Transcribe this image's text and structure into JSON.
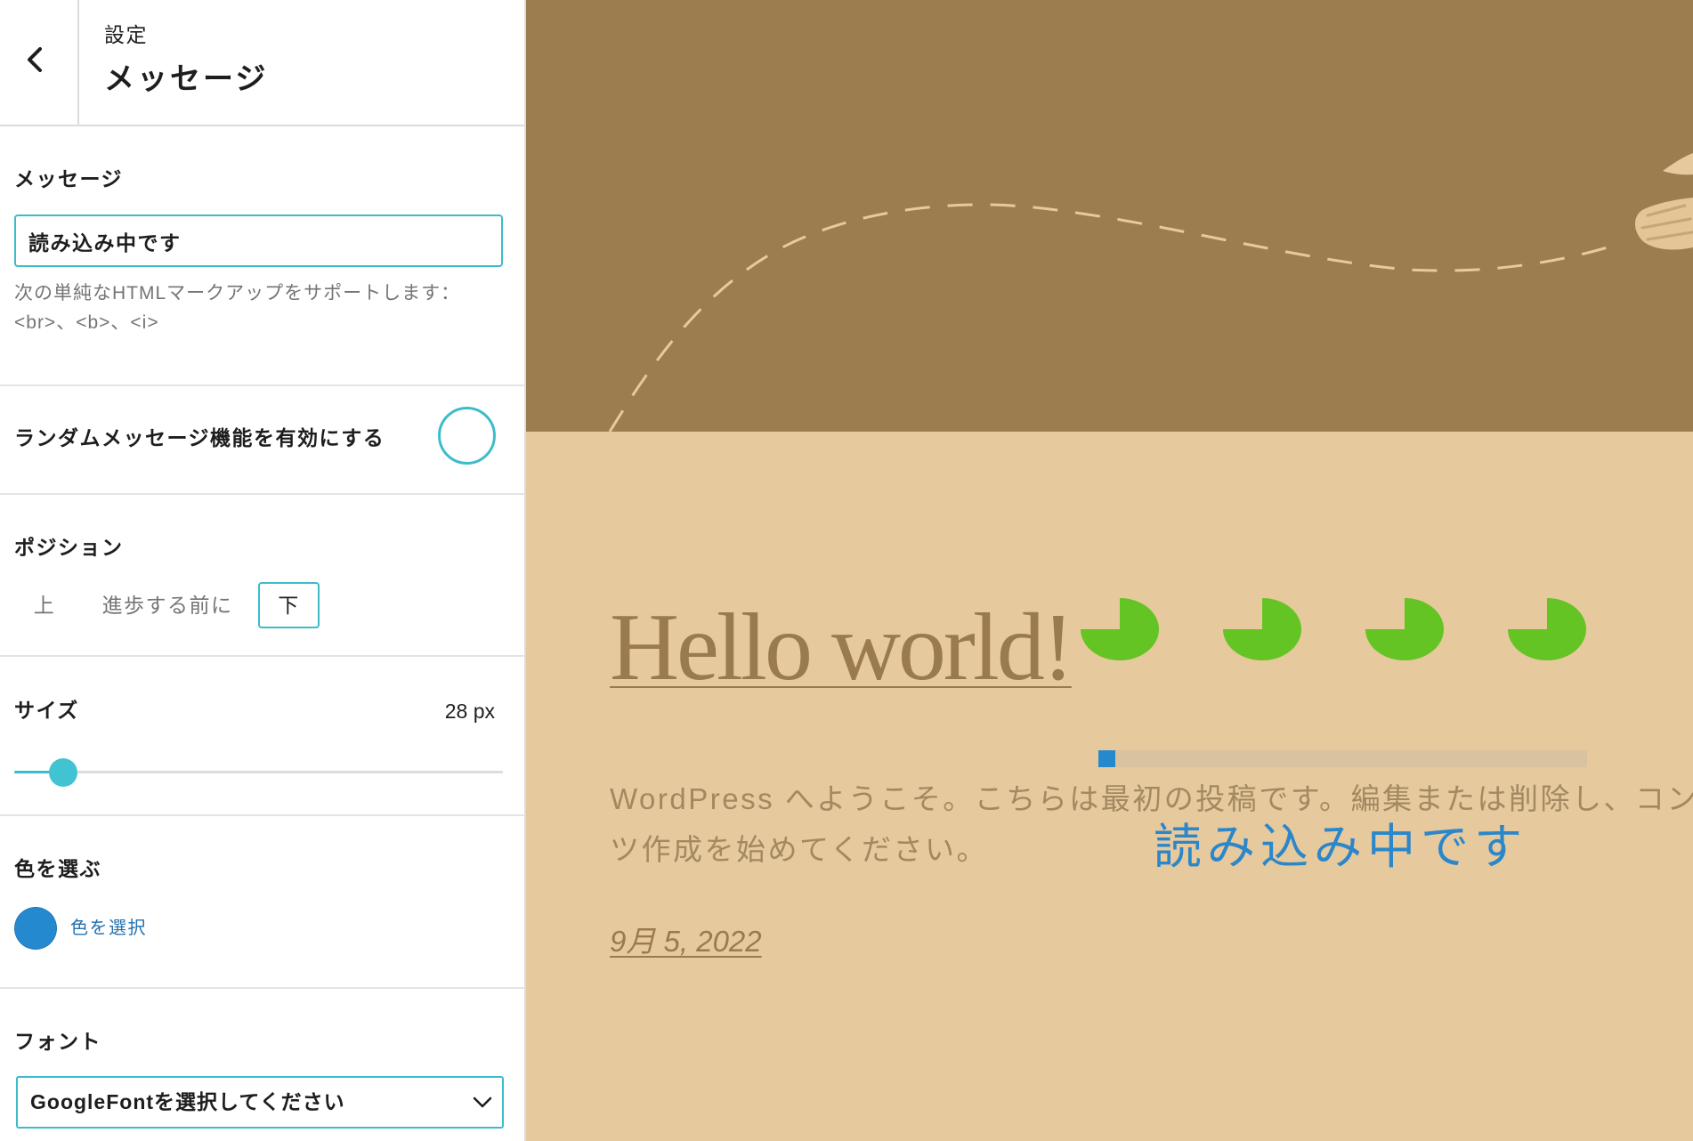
{
  "panel": {
    "accent_color": "#3cbccb",
    "header": {
      "back_icon": "chevron-left-icon",
      "breadcrumb": "設定",
      "title": "メッセージ"
    },
    "message": {
      "label": "メッセージ",
      "value": "読み込み中です",
      "help_line1": "次の単純なHTMLマークアップをサポートします：",
      "help_line2": "<br>、<b>、<i>"
    },
    "random_message": {
      "label": "ランダムメッセージ機能を有効にする",
      "enabled": false
    },
    "position": {
      "label": "ポジション",
      "options": [
        "上",
        "進歩する前に",
        "下"
      ],
      "selected": "下"
    },
    "size": {
      "label": "サイズ",
      "value": 28,
      "unit": "px",
      "slider_level": 0.1
    },
    "color": {
      "label": "色を選ぶ",
      "swatch": "#2589cf",
      "link": "色を選択"
    },
    "font": {
      "label": "フォント",
      "selected": "GoogleFontを選択してください",
      "chevron_icon": "chevron-down-icon"
    }
  },
  "preview": {
    "header_band_color": "#9c7d50",
    "background_color": "#e6c99d",
    "text_color": "#9a7b4f",
    "illustration": "bird-illustration",
    "post_title": "Hello world!",
    "excerpt_line1": "WordPress へようこそ。こちらは最初の投稿です。編集または削除し、コン",
    "excerpt_line2": "ツ作成を始めてください。",
    "date": "9月 5, 2022",
    "loader": {
      "dot_color": "#64c423",
      "progress": 0.035,
      "bar_color": "#2688cd",
      "message": "読み込み中です",
      "message_color": "#2b87c9"
    }
  }
}
